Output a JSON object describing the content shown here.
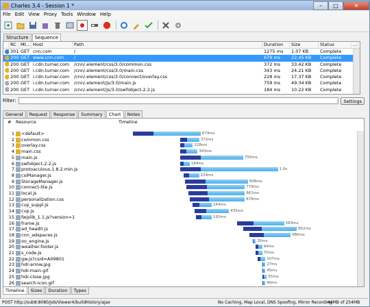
{
  "window": {
    "title": "Charles 3.4 - Session 1 *"
  },
  "menu": [
    "File",
    "Edit",
    "View",
    "Proxy",
    "Tools",
    "Window",
    "Help"
  ],
  "toolbar_icons": [
    "new-session-icon",
    "open-icon",
    "save-icon",
    "clear-icon",
    "trash-icon",
    "tools-icon",
    "record-icon",
    "throttle-icon",
    "breakpoint-icon",
    "repeat-icon",
    "edit-icon",
    "validate-icon",
    "tools2-icon",
    "settings-icon"
  ],
  "top_tabs": [
    "Structure",
    "Sequence"
  ],
  "sequence_table": {
    "headers": [
      "RC",
      "Mt...",
      "Host",
      "Path",
      "Duration",
      "Size",
      "Status"
    ],
    "rows": [
      {
        "rc": "301",
        "method": "GET",
        "host": "cnn.com",
        "path": "/",
        "duration": "1275 ms",
        "size": "1.07 KB",
        "status": "Complete",
        "icon": "#4a7fc0"
      },
      {
        "rc": "200",
        "method": "GET",
        "host": "www.cnn.com",
        "path": "/",
        "duration": "679 ms",
        "size": "22.45 KB",
        "status": "Complete",
        "icon": "#e0b030"
      },
      {
        "rc": "200",
        "method": "GET",
        "host": "i.cdn.turner.com",
        "path": "/cnn/.element/css/3.0/common.css",
        "duration": "372 ms",
        "size": "33.42 KB",
        "status": "Complete",
        "icon": "#e0b030"
      },
      {
        "rc": "200",
        "method": "GET",
        "host": "i.cdn.turner.com",
        "path": "/cnn/.element/css/3.0/main.css",
        "duration": "343 ms",
        "size": "24.21 KB",
        "status": "Complete",
        "icon": "#e0b030"
      },
      {
        "rc": "200",
        "method": "GET",
        "host": "i.cdn.turner.com",
        "path": "/cnn/.element/css/3.0/connect/overlay.css",
        "duration": "228 ms",
        "size": "17.37 KB",
        "status": "Complete",
        "icon": "#e0b030"
      },
      {
        "rc": "200",
        "method": "GET",
        "host": "i.cdn.turner.com",
        "path": "/cnn/.element/js/3.0/main.js",
        "duration": "759 ms",
        "size": "49.34 KB",
        "status": "Complete",
        "icon": "#aaaaaa"
      },
      {
        "rc": "200",
        "method": "GET",
        "host": "i.cdn.turner.com",
        "path": "/cnn/.element/js/3.0/swfobject-2.2.js",
        "duration": "184 ms",
        "size": "10.22 KB",
        "status": "Complete",
        "icon": "#aaaaaa"
      }
    ]
  },
  "filter": {
    "label": "Filter:",
    "value": "",
    "settings_label": "Settings"
  },
  "mid_tabs": [
    "General",
    "Request",
    "Response",
    "Summary",
    "Chart",
    "Notes"
  ],
  "chart_header": {
    "num": "#",
    "resource": "Resource",
    "timeline": "Timeline"
  },
  "chart_data": {
    "type": "table",
    "resources": [
      {
        "n": "1",
        "name": "<default>",
        "start": 10,
        "len": 43,
        "label": "679ms"
      },
      {
        "n": "2",
        "name": "common.css",
        "start": 40,
        "len": 12,
        "label": "372ms"
      },
      {
        "n": "3",
        "name": "overlay.css",
        "start": 40,
        "len": 8,
        "label": "228ms"
      },
      {
        "n": "4",
        "name": "main.css",
        "start": 40,
        "len": 11,
        "label": "343ms"
      },
      {
        "n": "5",
        "name": "main.js",
        "start": 40,
        "len": 40,
        "label": "759ms"
      },
      {
        "n": "6",
        "name": "swfobject-2.2.js",
        "start": 40,
        "len": 6,
        "label": "184ms"
      },
      {
        "n": "7",
        "name": "protoaculous.1.8.2.min.js",
        "start": 40,
        "len": 62,
        "label": "1.0s"
      },
      {
        "n": "8",
        "name": "csiManager.js",
        "start": 42,
        "len": 10,
        "label": "224ms"
      },
      {
        "n": "9",
        "name": "StorageManager.js",
        "start": 43,
        "len": 40,
        "label": "808ms"
      },
      {
        "n": "10",
        "name": "connect-lite.js",
        "start": 44,
        "len": 37,
        "label": "779ms"
      },
      {
        "n": "11",
        "name": "local.js",
        "start": 45,
        "len": 36,
        "label": "661ms"
      },
      {
        "n": "12",
        "name": "personalization.css",
        "start": 46,
        "len": 35,
        "label": "676ms"
      },
      {
        "n": "13",
        "name": "cvp_suppl.js",
        "start": 48,
        "len": 12,
        "label": "244ms"
      },
      {
        "n": "14",
        "name": "cvp.js",
        "start": 49,
        "len": 22,
        "label": "435ms"
      },
      {
        "n": "15",
        "name": "fwjslib_1.1.js?version=1",
        "start": 50,
        "len": 10,
        "label": "193ms"
      },
      {
        "n": "16",
        "name": "frame.js",
        "start": 76,
        "len": 30,
        "label": "583ms"
      },
      {
        "n": "17",
        "name": "ad_head0.js",
        "start": 80,
        "len": 34,
        "label": "652ms"
      },
      {
        "n": "18",
        "name": "cnn_adspaces.js",
        "start": 84,
        "len": 26,
        "label": "486ms"
      },
      {
        "n": "19",
        "name": "oo_engine.js",
        "start": 86,
        "len": 2,
        "label": "35ms"
      },
      {
        "n": "20",
        "name": "weather.footer.js",
        "start": 88,
        "len": 4,
        "label": "94ms"
      },
      {
        "n": "21",
        "name": "s_code.js",
        "start": 88,
        "len": 4,
        "label": "70ms"
      },
      {
        "n": "22",
        "name": "gw.js?csid=A09801",
        "start": 89,
        "len": 5,
        "label": "107ms"
      },
      {
        "n": "23",
        "name": "hdr-arrow.jpg",
        "start": 92,
        "len": 2,
        "label": "27ms"
      },
      {
        "n": "24",
        "name": "hdr-main.gif",
        "start": 92,
        "len": 2,
        "label": "45ms"
      },
      {
        "n": "25",
        "name": "hdr-close.jpg",
        "start": 92,
        "len": 3,
        "label": "55ms"
      },
      {
        "n": "26",
        "name": "search-icon.gif",
        "start": 92,
        "len": 2,
        "label": "40ms"
      }
    ],
    "colors": {
      "wait": "#2a3c9c",
      "receive": "#4fb0e8",
      "bar_light": "#8ccff5"
    }
  },
  "bottom_tabs": [
    "Timeline",
    "Sizes",
    "Duration",
    "Types"
  ],
  "status": {
    "left": "POST http://sub8:8080/job/Viewer4/buildHistory/ajax",
    "mid": "No Caching, Map Local, DNS Spoofing, Mirror   Recording",
    "mem": "44MB of 254MB"
  }
}
